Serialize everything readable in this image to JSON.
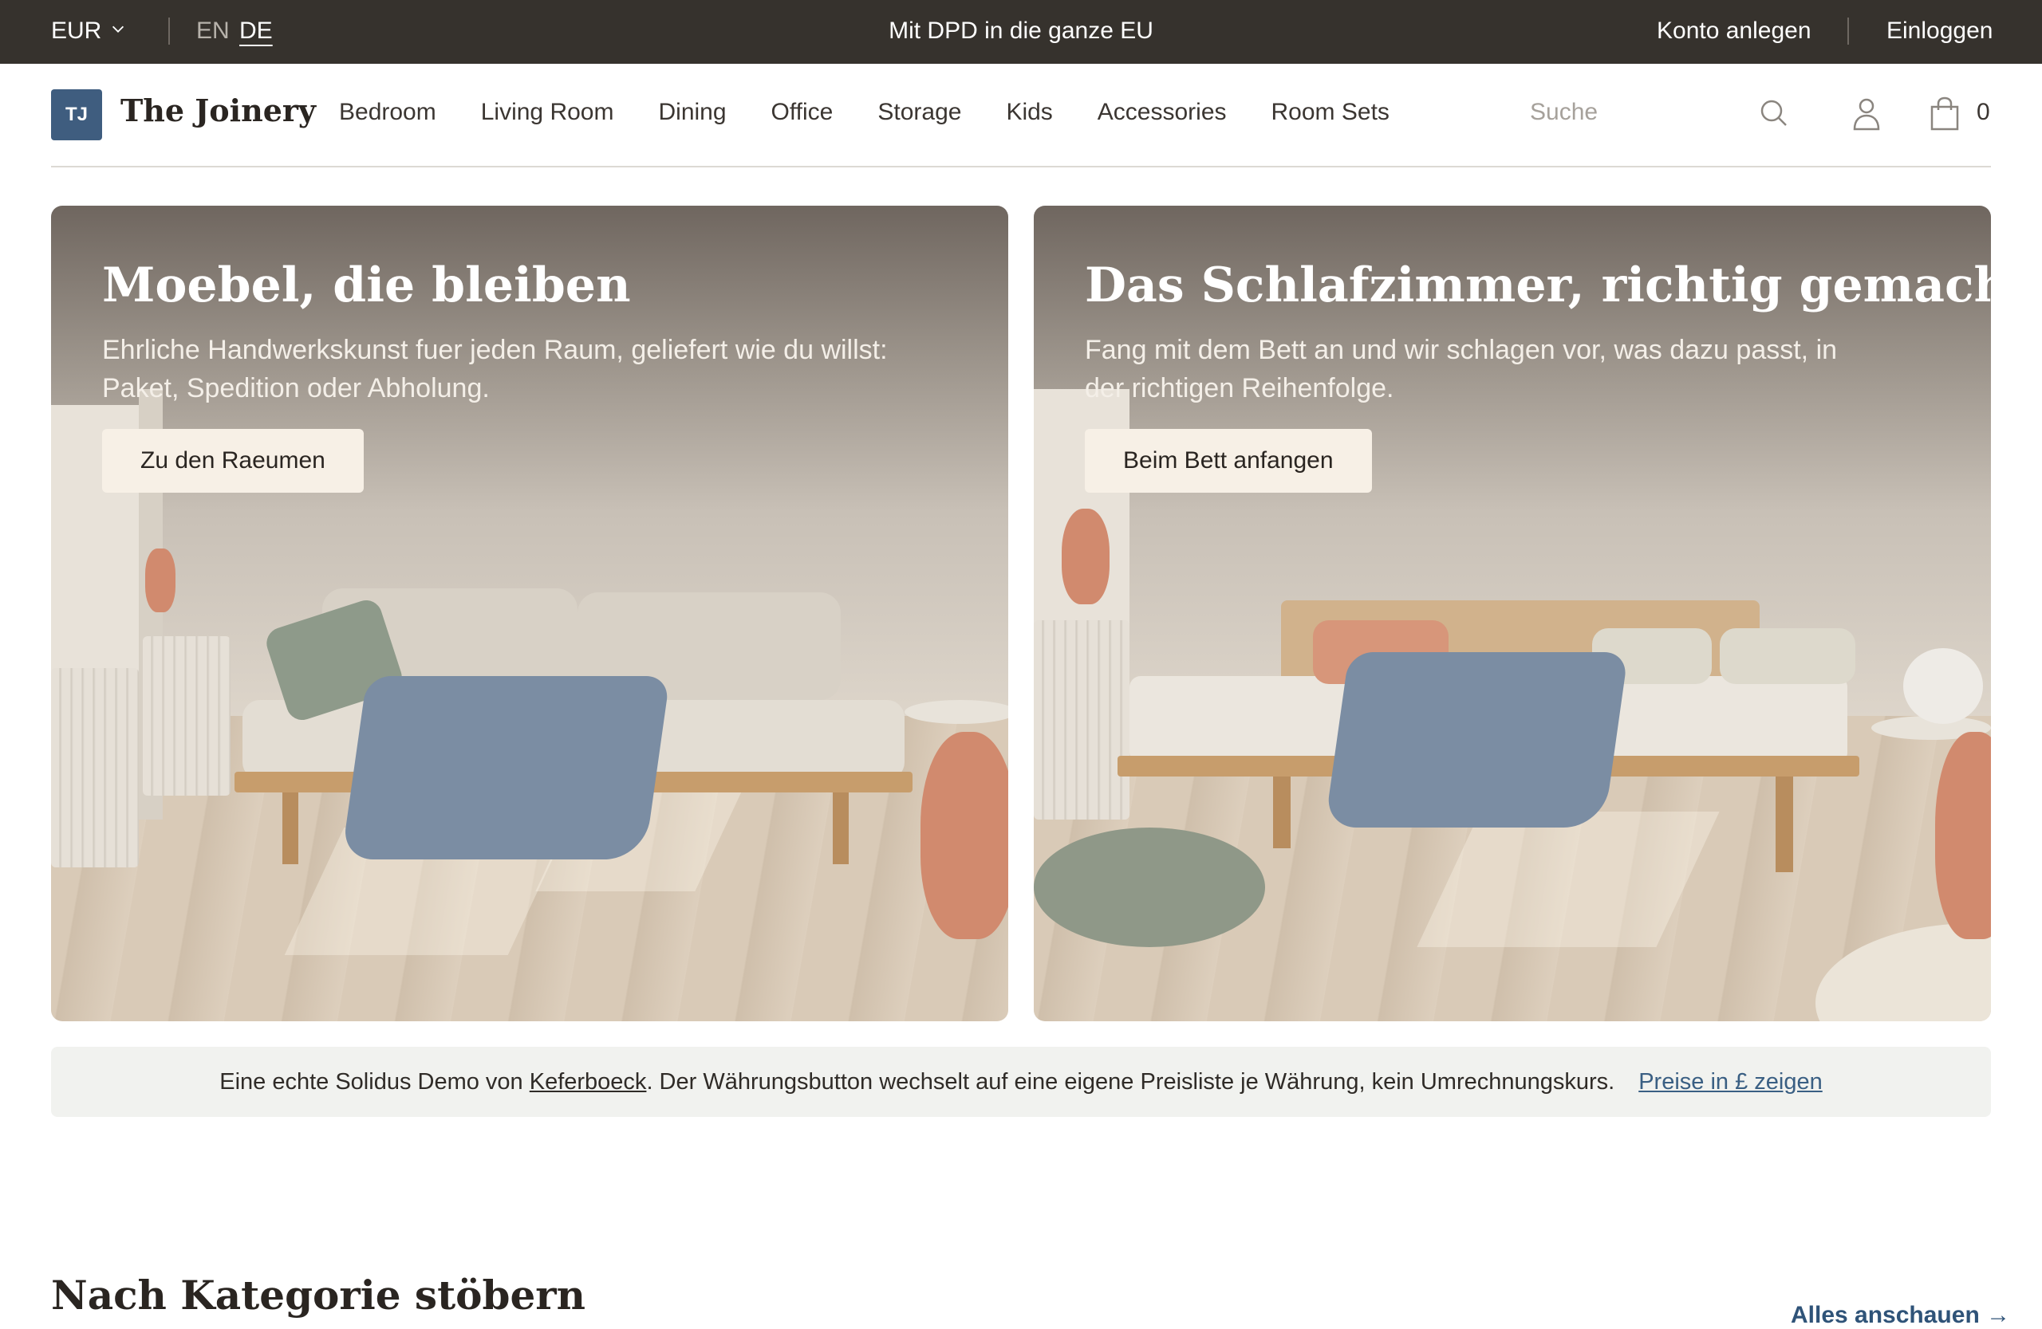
{
  "topbar": {
    "currency": "EUR",
    "lang_en": "EN",
    "lang_de": "DE",
    "promo": "Mit DPD in die ganze EU",
    "account_link": "Konto anlegen",
    "login_link": "Einloggen"
  },
  "header": {
    "logo_initials": "TJ",
    "brand": "The Joinery",
    "nav": [
      "Bedroom",
      "Living Room",
      "Dining",
      "Office",
      "Storage",
      "Kids",
      "Accessories",
      "Room Sets"
    ],
    "search_placeholder": "Suche",
    "cart_count": "0"
  },
  "hero": [
    {
      "title": "Moebel, die bleiben",
      "subtitle": "Ehrliche Handwerkskunst fuer jeden Raum, geliefert wie du willst: Paket, Spedition oder Abholung.",
      "button": "Zu den Raeumen"
    },
    {
      "title": "Das Schlafzimmer, richtig gemacht",
      "subtitle": "Fang mit dem Bett an und wir schlagen vor, was dazu passt, in der richtigen Reihenfolge.",
      "button": "Beim Bett anfangen"
    }
  ],
  "infobar": {
    "prefix": "Eine echte Solidus Demo von ",
    "link": "Keferboeck",
    "suffix": ". Der Währungsbutton wechselt auf eine eigene Preisliste je Währung, kein Umrechnungskurs.",
    "price_link": "Preise in £ zeigen"
  },
  "categories": {
    "title": "Nach Kategorie stöbern",
    "see_all": "Alles anschauen →"
  },
  "colors": {
    "topbar_bg": "#36322d",
    "logo_bg": "#3f5d7f",
    "link_blue": "#3a5f83",
    "cta_bg": "#f7f0e6"
  }
}
